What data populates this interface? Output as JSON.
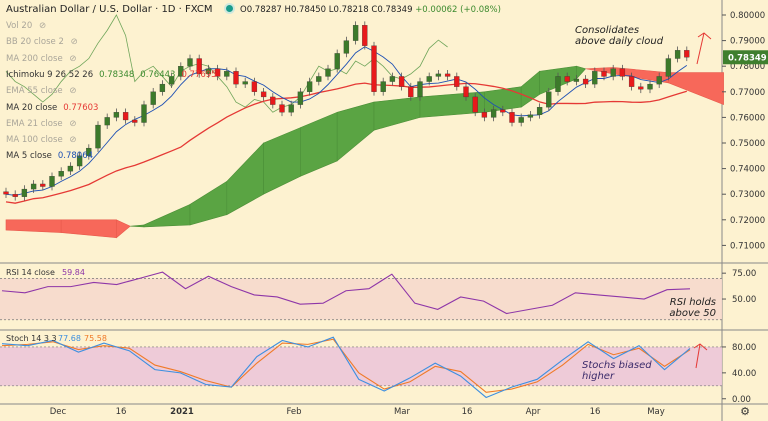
{
  "header": {
    "symbol": "Australian Dollar / U.S. Dollar · 1D · FXCM",
    "open": "O0.78287",
    "high": "H0.78450",
    "low": "L0.78218",
    "close": "C0.78349",
    "change": "+0.00062 (+0.08%)"
  },
  "legend": [
    {
      "label": "Vol 20",
      "hidden": true
    },
    {
      "label": "BB 20 close 2",
      "hidden": true
    },
    {
      "label": "MA 200 close",
      "hidden": true
    },
    {
      "label": "Ichimoku 9 26 52 26",
      "values": [
        "0.78348",
        "0.76443",
        "0.77695"
      ],
      "colors": [
        "#3c8a2e",
        "#3c8a2e",
        "#e53935"
      ]
    },
    {
      "label": "EMA 55 close",
      "hidden": true
    },
    {
      "label": "MA 20 close",
      "values": [
        "0.77603"
      ],
      "colors": [
        "#e53935"
      ]
    },
    {
      "label": "EMA 21 close",
      "hidden": true
    },
    {
      "label": "MA 100 close",
      "hidden": true
    },
    {
      "label": "MA 5 close",
      "values": [
        "0.78064"
      ],
      "colors": [
        "#1e50b4"
      ]
    }
  ],
  "annotations": {
    "price": [
      "Consolidates",
      "above daily cloud"
    ],
    "rsi": [
      "RSI holds",
      "above 50"
    ],
    "stoch": [
      "Stochs biased",
      "higher"
    ]
  },
  "colors": {
    "background": "#fdf2d0",
    "up": "#3c7a2a",
    "down": "#e8191b",
    "cloud_bull": "#5aa443",
    "cloud_bear": "#f7685a",
    "ma20": "#e53935",
    "ma5": "#1e50b4",
    "rsi": "#8e36a8",
    "stoch_k": "#3d8fe0",
    "stoch_d": "#f07a28",
    "last_price_bg": "#3f7f2e"
  },
  "chart_data": [
    {
      "type": "candlestick",
      "title": "Australian Dollar / U.S. Dollar · 1D · FXCM",
      "ylim": [
        0.705,
        0.805
      ],
      "y_ticks": [
        "0.80000",
        "0.79000",
        "0.78000",
        "0.77000",
        "0.76000",
        "0.75000",
        "0.74000",
        "0.73000",
        "0.72000",
        "0.71000"
      ],
      "x_ticks": [
        "Dec",
        "16",
        "2021",
        "Feb",
        "Mar",
        "16",
        "Apr",
        "16",
        "May"
      ],
      "last_price": "0.78349",
      "close": [
        0.73,
        0.729,
        0.732,
        0.734,
        0.733,
        0.737,
        0.739,
        0.741,
        0.745,
        0.748,
        0.757,
        0.76,
        0.762,
        0.759,
        0.758,
        0.765,
        0.77,
        0.773,
        0.776,
        0.78,
        0.783,
        0.777,
        0.779,
        0.776,
        0.778,
        0.773,
        0.774,
        0.77,
        0.768,
        0.765,
        0.762,
        0.765,
        0.77,
        0.774,
        0.776,
        0.779,
        0.785,
        0.79,
        0.796,
        0.788,
        0.77,
        0.774,
        0.776,
        0.772,
        0.768,
        0.774,
        0.776,
        0.777,
        0.776,
        0.772,
        0.768,
        0.762,
        0.76,
        0.763,
        0.762,
        0.758,
        0.76,
        0.761,
        0.764,
        0.77,
        0.776,
        0.774,
        0.775,
        0.773,
        0.778,
        0.776,
        0.779,
        0.776,
        0.772,
        0.771,
        0.773,
        0.776,
        0.783,
        0.7862,
        0.7835
      ],
      "ichimoku_cloud": [
        [
          0,
          0.716,
          0.72
        ],
        [
          6,
          0.715,
          0.72
        ],
        [
          12,
          0.713,
          0.72
        ],
        [
          13.5,
          0.7175,
          0.7175
        ],
        [
          15,
          0.718,
          0.7172
        ],
        [
          20,
          0.726,
          0.718
        ],
        [
          24,
          0.735,
          0.722
        ],
        [
          28,
          0.75,
          0.73
        ],
        [
          32,
          0.756,
          0.737
        ],
        [
          36,
          0.762,
          0.743
        ],
        [
          40,
          0.766,
          0.755
        ],
        [
          45,
          0.768,
          0.76
        ],
        [
          52,
          0.77,
          0.762
        ],
        [
          56,
          0.772,
          0.764
        ],
        [
          58,
          0.778,
          0.769
        ],
        [
          62,
          0.78,
          0.775
        ],
        [
          63,
          0.779,
          0.779
        ],
        [
          66,
          0.777,
          0.7795
        ],
        [
          72,
          0.7735,
          0.7775
        ],
        [
          78,
          0.765,
          0.7775
        ]
      ]
    },
    {
      "type": "line",
      "name": "RSI 14 close",
      "value_label": "59.84",
      "ylim": [
        22,
        80
      ],
      "y_ticks": [
        "75.00",
        "50.00"
      ],
      "bands": [
        70,
        30
      ],
      "values": [
        58,
        56,
        62,
        62,
        66,
        64,
        70,
        76,
        60,
        72,
        62,
        54,
        52,
        45,
        46,
        58,
        60,
        74,
        46,
        40,
        52,
        48,
        36,
        40,
        44,
        56,
        54,
        52,
        50,
        59,
        59.84
      ]
    },
    {
      "type": "line",
      "name": "Stoch 14 3 3",
      "k_label": "77.68",
      "d_label": "75.58",
      "ylim": [
        -5,
        100
      ],
      "y_ticks": [
        "80.00",
        "40.00",
        "0.00"
      ],
      "bands": [
        80,
        20
      ],
      "k": [
        85,
        82,
        90,
        72,
        86,
        74,
        45,
        40,
        22,
        18,
        65,
        90,
        80,
        95,
        30,
        12,
        32,
        55,
        35,
        2,
        18,
        30,
        60,
        88,
        62,
        82,
        45,
        77.68
      ],
      "d": [
        82,
        84,
        88,
        76,
        82,
        78,
        52,
        42,
        28,
        18,
        55,
        86,
        84,
        92,
        40,
        15,
        26,
        50,
        42,
        10,
        15,
        26,
        52,
        84,
        68,
        78,
        50,
        75.58
      ]
    }
  ]
}
